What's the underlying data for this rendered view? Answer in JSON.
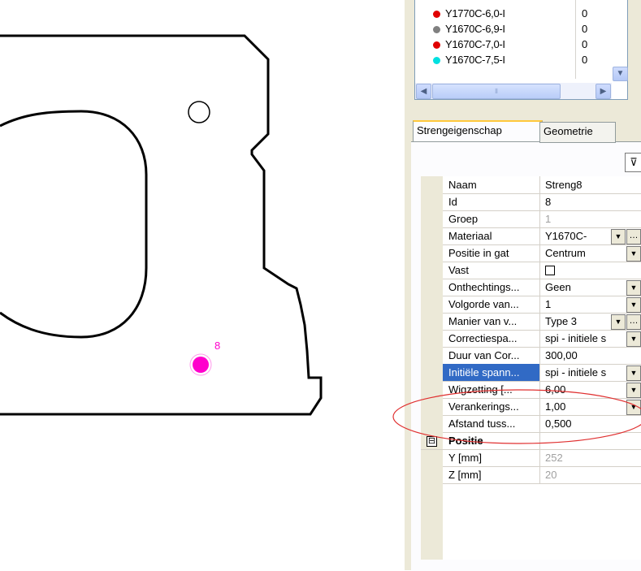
{
  "drawing": {
    "strand_label": "8",
    "colors": {
      "outline": "#000000",
      "strand": "#ff00cc",
      "strand_label": "#ff00cc"
    }
  },
  "materials": {
    "rows": [
      {
        "name": "Y1770C-6,0-I",
        "value": "0",
        "color": "#e00000"
      },
      {
        "name": "Y1670C-6,9-I",
        "value": "0",
        "color": "#808080"
      },
      {
        "name": "Y1670C-7,0-I",
        "value": "0",
        "color": "#e00000"
      },
      {
        "name": "Y1670C-7,5-I",
        "value": "0",
        "color": "#00e0e0"
      }
    ]
  },
  "tabs": [
    {
      "label": "Strengeigenschap"
    },
    {
      "label": "Geometrie"
    }
  ],
  "properties": [
    {
      "label": "Naam",
      "value": "Streng8"
    },
    {
      "label": "Id",
      "value": "8"
    },
    {
      "label": "Groep",
      "value": "1"
    },
    {
      "label": "Materiaal",
      "value": "Y1670C-"
    },
    {
      "label": "Positie in gat",
      "value": "Centrum"
    },
    {
      "label": "Vast",
      "value": ""
    },
    {
      "label": "Onthechtings...",
      "value": "Geen"
    },
    {
      "label": "Volgorde van...",
      "value": "1"
    },
    {
      "label": "Manier van v...",
      "value": "Type 3"
    },
    {
      "label": "Correctiespa...",
      "value": "spi - initiele s"
    },
    {
      "label": "Duur van Cor...",
      "value": "300,00"
    },
    {
      "label": "Initiële spann...",
      "value": "spi - initiele s"
    },
    {
      "label": "Wigzetting [...",
      "value": "6,00"
    },
    {
      "label": "Verankerings...",
      "value": "1,00"
    },
    {
      "label": "Afstand tuss...",
      "value": "0,500"
    }
  ],
  "position_category": {
    "expander": "⊟",
    "label": "Positie",
    "rows": [
      {
        "label": "Y [mm]",
        "value": "252"
      },
      {
        "label": "Z [mm]",
        "value": "20"
      }
    ]
  },
  "annotation_color": "#e03030"
}
